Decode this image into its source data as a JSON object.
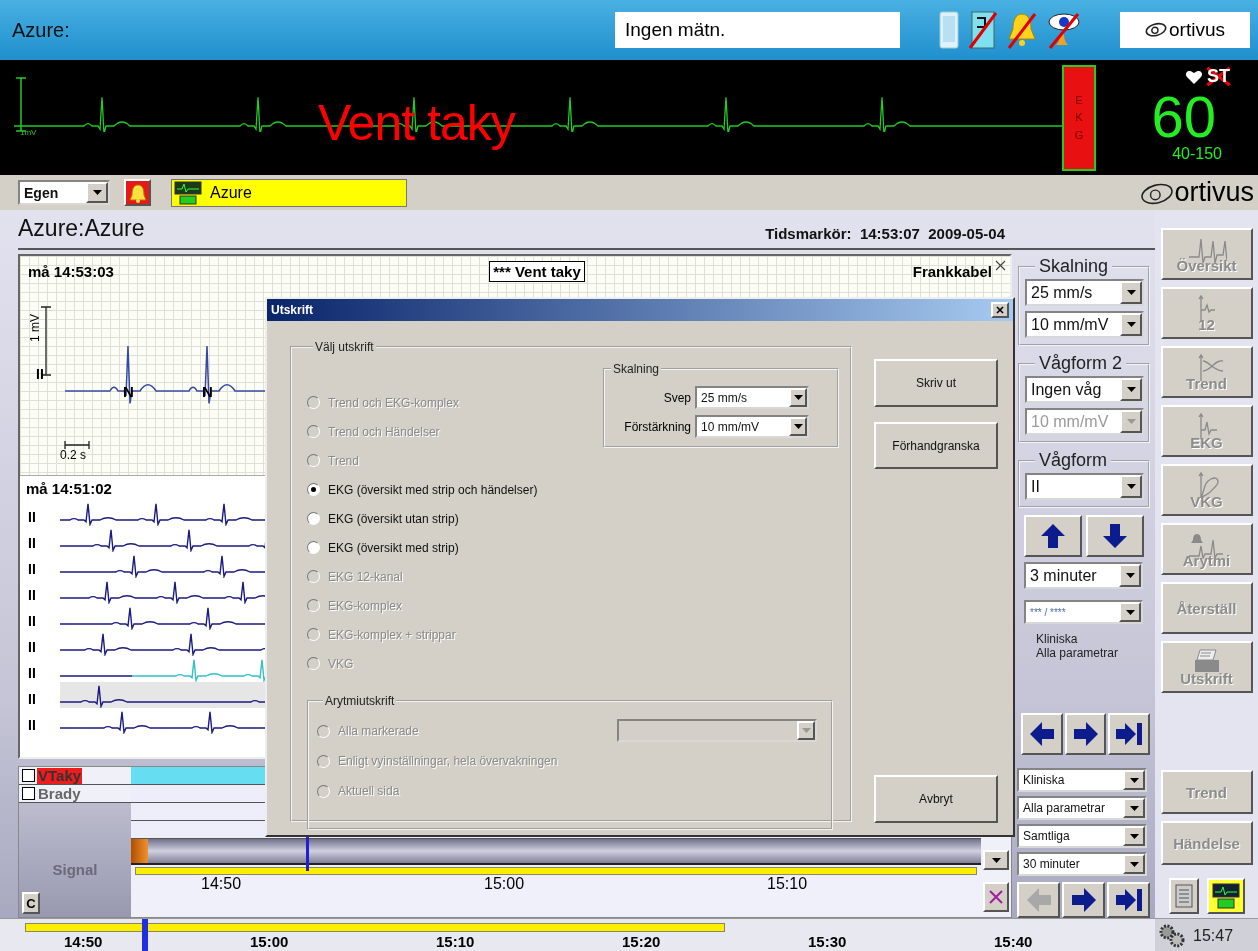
{
  "top_bar": {
    "title": "Azure:",
    "measurement": "Ingen mätn.",
    "logo": "ortivus"
  },
  "monitor": {
    "scale": "1mV",
    "alarm": "Vent taky",
    "lead_box": "EKG",
    "st_label": "ST",
    "heart_rate": "60",
    "limits": "40-150"
  },
  "toolbar": {
    "profile": "Egen",
    "patient": "Azure",
    "logo": "ortivus"
  },
  "page": {
    "title": "Azure:Azure",
    "time_marker": "Tidsmarkör:  14:53:07  2009-05-04"
  },
  "strip": {
    "timestamp": "må 14:53:03",
    "event": "*** Vent taky",
    "cable": "Frankkabel",
    "scale": "1 mV",
    "lead": "II",
    "beat_labels": [
      "N",
      "N"
    ],
    "time_scale": "0.2 s"
  },
  "rhythm": {
    "timestamp": "må 14:51:02",
    "rows": [
      {
        "lead": "II",
        "highlighted": false,
        "marked": false
      },
      {
        "lead": "II",
        "highlighted": false,
        "marked": false
      },
      {
        "lead": "II",
        "highlighted": false,
        "marked": false
      },
      {
        "lead": "II",
        "highlighted": false,
        "marked": false
      },
      {
        "lead": "II",
        "highlighted": false,
        "marked": false
      },
      {
        "lead": "II",
        "highlighted": false,
        "marked": false
      },
      {
        "lead": "II",
        "highlighted": false,
        "marked": true
      },
      {
        "lead": "II",
        "highlighted": true,
        "marked": false
      },
      {
        "lead": "II",
        "highlighted": false,
        "marked": false
      }
    ]
  },
  "scaling": {
    "legend": "Skalning",
    "speed": "25 mm/s",
    "gain": "10 mm/mV"
  },
  "waveform_2": {
    "legend": "Vågform 2",
    "wave": "Ingen våg",
    "gain": "10 mm/mV",
    "gain_disabled": true
  },
  "waveform": {
    "legend": "Vågform",
    "lead": "II"
  },
  "duration": "3 minuter",
  "filter": "*** / ****",
  "filter_notes": [
    "Kliniska",
    "Alla parametrar"
  ],
  "side_buttons": [
    {
      "label": "Översikt"
    },
    {
      "label": "12"
    },
    {
      "label": "Trend"
    },
    {
      "label": "EKG"
    },
    {
      "label": "VKG"
    },
    {
      "label": "Arytmi"
    },
    {
      "label": "Återställ"
    },
    {
      "label": "Utskrift"
    }
  ],
  "timeline": {
    "rows": [
      {
        "label": "VTaky",
        "checked": false,
        "alarm": true
      },
      {
        "label": "Brady",
        "checked": false,
        "alarm": false
      }
    ],
    "signal_label": "Signal",
    "clear_button": "C",
    "ticks": [
      "14:50",
      "15:00",
      "15:10"
    ]
  },
  "filters": [
    "Kliniska",
    "Alla parametrar",
    "Samtliga",
    "30 minuter"
  ],
  "timeline_nav": {
    "back_disabled": true
  },
  "lower_buttons": [
    "Trend",
    "Händelse"
  ],
  "time_axis": {
    "ticks": [
      "14:50",
      "15:00",
      "15:10",
      "15:20",
      "15:30",
      "15:40"
    ],
    "clock": "15:47"
  },
  "dialog": {
    "title": "Utskrift",
    "group": "Välj utskrift",
    "options": [
      {
        "label": "Trend och EKG-komplex",
        "selected": false,
        "disabled": true
      },
      {
        "label": "Trend och Händelser",
        "selected": false,
        "disabled": true
      },
      {
        "label": "Trend",
        "selected": false,
        "disabled": true
      },
      {
        "label": "EKG (översikt med strip och händelser)",
        "selected": true,
        "disabled": false
      },
      {
        "label": "EKG (översikt utan strip)",
        "selected": false,
        "disabled": false
      },
      {
        "label": "EKG (översikt med strip)",
        "selected": false,
        "disabled": false
      },
      {
        "label": "EKG 12-kanal",
        "selected": false,
        "disabled": true
      },
      {
        "label": "EKG-komplex",
        "selected": false,
        "disabled": true
      },
      {
        "label": "EKG-komplex + strippar",
        "selected": false,
        "disabled": true
      },
      {
        "label": "VKG",
        "selected": false,
        "disabled": true
      }
    ],
    "scaling": {
      "legend": "Skalning",
      "sweep_label": "Svep",
      "sweep": "25 mm/s",
      "gain_label": "Förstärkning",
      "gain": "10 mm/mV"
    },
    "arrhythmia": {
      "legend": "Arytmiutskrift",
      "select_disabled": true,
      "options": [
        {
          "label": "Alla markerade",
          "selected": false,
          "disabled": true
        },
        {
          "label": "Enligt vyinställningar, hela övervakningen",
          "selected": false,
          "disabled": true
        },
        {
          "label": "Aktuell sida",
          "selected": false,
          "disabled": true
        }
      ]
    },
    "buttons": [
      "Skriv ut",
      "Förhandgranska",
      "Avbryt"
    ]
  }
}
